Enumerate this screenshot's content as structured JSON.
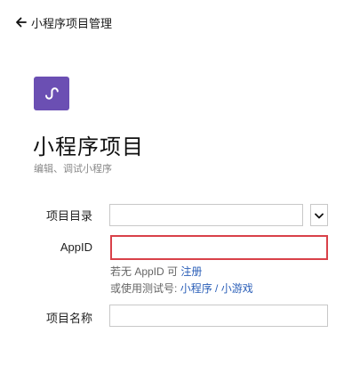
{
  "header": {
    "back_icon": "arrow-left-icon",
    "title": "小程序项目管理"
  },
  "app": {
    "logo_icon": "mini-program-logo-icon",
    "logo_color": "#6b4fb3",
    "title": "小程序项目",
    "subtitle": "编辑、调试小程序"
  },
  "form": {
    "project_dir": {
      "label": "项目目录",
      "value": "",
      "dropdown_icon": "chevron-down-icon"
    },
    "appid": {
      "label": "AppID",
      "value": "",
      "highlight_color": "#d94149"
    },
    "appid_hint": {
      "no_appid_prefix": "若无 AppID 可",
      "register_link": "注册",
      "test_prefix": "或使用测试号:",
      "mini_program_link": "小程序",
      "separator": "/",
      "mini_game_link": "小游戏"
    },
    "project_name": {
      "label": "项目名称",
      "value": ""
    }
  }
}
